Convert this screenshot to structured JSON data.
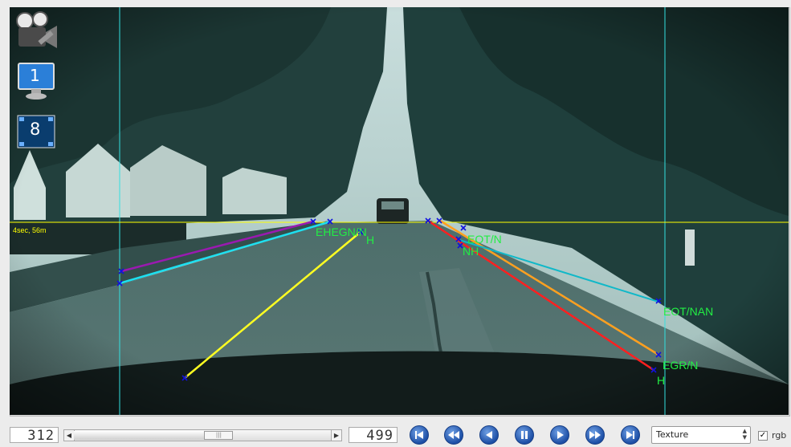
{
  "overlay": {
    "time_marker": "4sec, 56m",
    "lane_labels": {
      "left_label_1": "EHEGN/N",
      "left_label_2": "H",
      "right_label_1": "EOT/N",
      "right_label_2": "NH",
      "far_right_1": "EOT/NAN",
      "far_right_2": "EGR/N",
      "far_right_3": "H"
    }
  },
  "side_icons": {
    "media": "film-camera-icon",
    "monitor_label": "1",
    "tiles_label": "8"
  },
  "toolbar": {
    "current_frame": "312",
    "total_frames": "499",
    "progress": 0.57,
    "render_mode": "Texture",
    "rgb_label": "rgb",
    "rgb_checked": "✓"
  },
  "colors": {
    "horizon": "#ffff00",
    "vertical_guides": "#33e0e0",
    "lane_purple": "#9a1ab0",
    "lane_cyan": "#1de0f0",
    "lane_yellow": "#ffff22",
    "lane_red": "#ff2020",
    "lane_orange": "#ffa020",
    "lane_teal": "#10b8c8",
    "label_green": "#22ee44",
    "marker_blue": "#1010e0"
  }
}
